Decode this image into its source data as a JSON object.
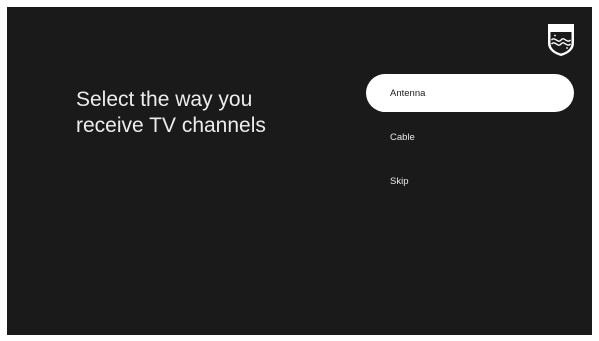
{
  "brand": {
    "name": "PHILIPS",
    "logo_icon": "philips-shield-icon"
  },
  "setup": {
    "heading": "Select the way you\nreceive TV channels"
  },
  "options": [
    {
      "label": "Antenna",
      "selected": true
    },
    {
      "label": "Cable",
      "selected": false
    },
    {
      "label": "Skip",
      "selected": false
    }
  ],
  "colors": {
    "background": "#1a1a1a",
    "selected_bg": "#ffffff",
    "text": "#ececec"
  }
}
